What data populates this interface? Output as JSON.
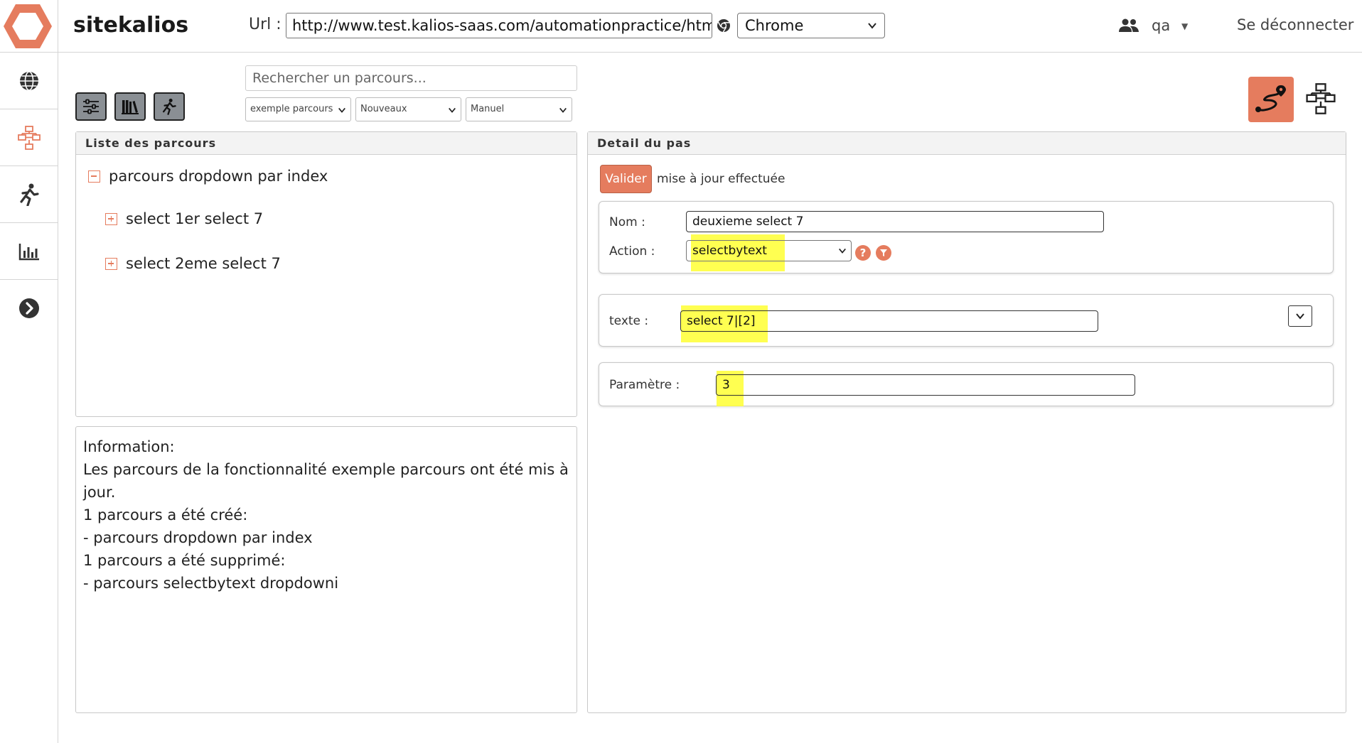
{
  "header": {
    "app_title": "sitekalios",
    "url_label": "Url :",
    "url_value": "http://www.test.kalios-saas.com/automationpractice/htm",
    "browser_selected": "Chrome",
    "user_name": "qa",
    "logout_label": "Se déconnecter"
  },
  "toolbar": {
    "search_placeholder": "Rechercher un parcours...",
    "filter_feature": "exemple parcours",
    "filter_status": "Nouveaux",
    "filter_mode": "Manuel"
  },
  "tree_panel": {
    "title": "Liste des parcours",
    "root": "parcours dropdown par index",
    "children": [
      "select 1er select 7",
      "select 2eme select 7"
    ]
  },
  "info": {
    "lines": [
      "Information:",
      "Les parcours de la fonctionnalité exemple parcours ont été mis à jour.",
      "1 parcours a été créé:",
      "- parcours dropdown par index",
      "1 parcours a été supprimé:",
      "- parcours selectbytext dropdowni"
    ]
  },
  "detail": {
    "title": "Detail du pas",
    "valider_label": "Valider",
    "status_text": "mise à jour effectuée",
    "nom_label": "Nom :",
    "nom_value": "deuxieme select 7",
    "action_label": "Action :",
    "action_value": "selectbytext",
    "texte_label": "texte :",
    "texte_value": "select 7|[2]",
    "parametre_label": "Paramètre :",
    "parametre_value": "3"
  },
  "colors": {
    "accent": "#e57c5e",
    "highlight": "#ffff33",
    "toolbar_button": "#8a8f94"
  },
  "icons": {
    "sidebar": [
      "globe-icon",
      "flowchart-icon",
      "runner-icon",
      "chart-icon",
      "chevron-right-circle-icon"
    ],
    "toolbar": [
      "sliders-icon",
      "library-icon",
      "runner-icon"
    ],
    "header": [
      "chrome-icon",
      "users-icon"
    ]
  }
}
